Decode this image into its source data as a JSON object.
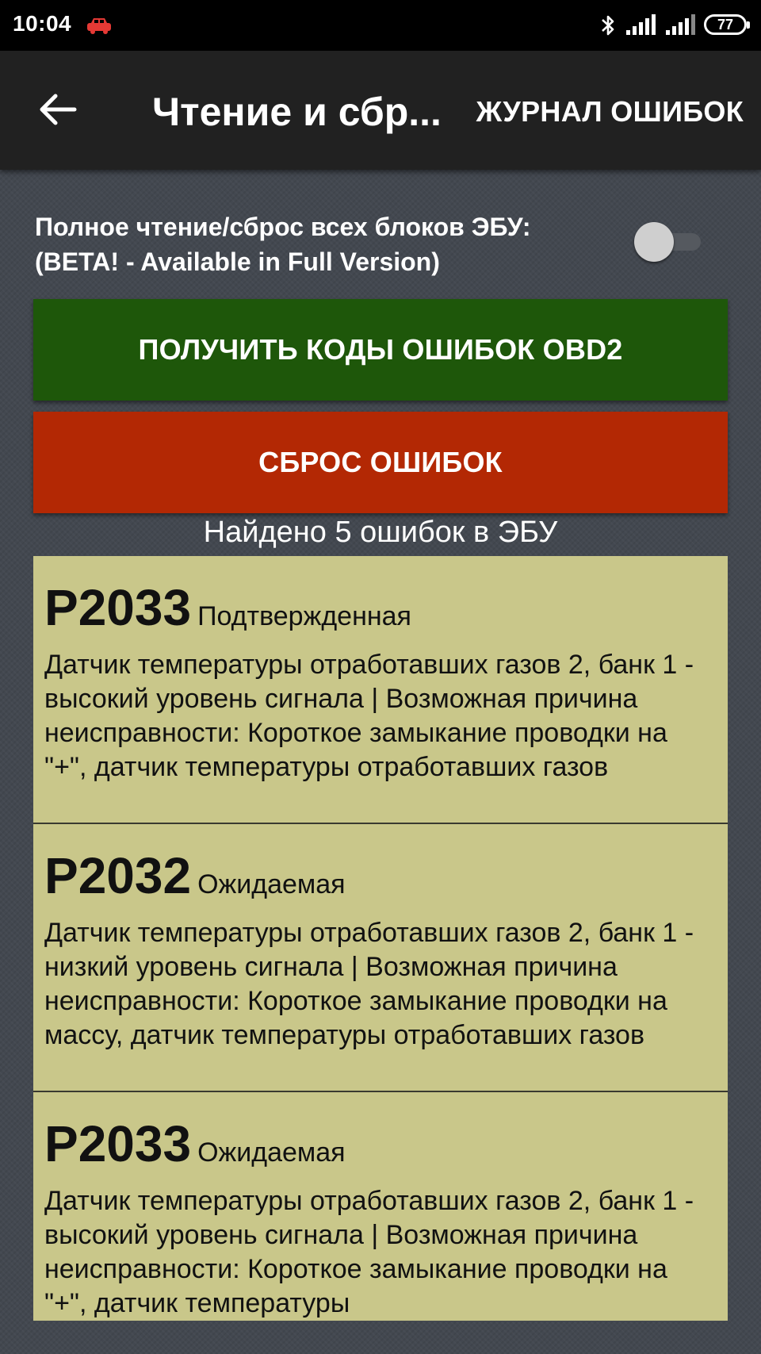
{
  "status_bar": {
    "time": "10:04",
    "battery": "77",
    "icons": [
      "car-icon",
      "bluetooth-icon",
      "signal-icon",
      "signal-icon",
      "battery-icon"
    ]
  },
  "app_bar": {
    "title": "Чтение и сбр...",
    "action": "ЖУРНАЛ ОШИБОК",
    "back_icon": "arrow-left-icon"
  },
  "toggle": {
    "label_line1": "Полное чтение/сброс всех блоков ЭБУ:",
    "label_line2": "(BETA! - Available in Full Version)",
    "checked": false
  },
  "buttons": {
    "read": "ПОЛУЧИТЬ КОДЫ ОШИБОК OBD2",
    "reset": "СБРОС ОШИБОК"
  },
  "found_text": "Найдено 5 ошибок в ЭБУ",
  "errors": [
    {
      "code": "P2033",
      "status": "Подтвержденная",
      "description": "Датчик температуры отработавших газов 2, банк 1 - высокий уровень сигнала | Возможная причина неисправности: Короткое замыкание проводки на \"+\", датчик температуры отработавших газов"
    },
    {
      "code": "P2032",
      "status": "Ожидаемая",
      "description": "Датчик температуры отработавших газов 2, банк 1 - низкий уровень сигнала | Возможная причина неисправности: Короткое замыкание проводки на массу, датчик температуры отработавших газов"
    },
    {
      "code": "P2033",
      "status": "Ожидаемая",
      "description": "Датчик температуры отработавших газов 2, банк 1 - высокий уровень сигнала | Возможная причина неисправности: Короткое замыкание проводки на \"+\", датчик температуры"
    }
  ],
  "colors": {
    "read_button": "#1e570a",
    "reset_button": "#b32804",
    "error_card": "#c9c78a",
    "app_bar": "#212121"
  }
}
